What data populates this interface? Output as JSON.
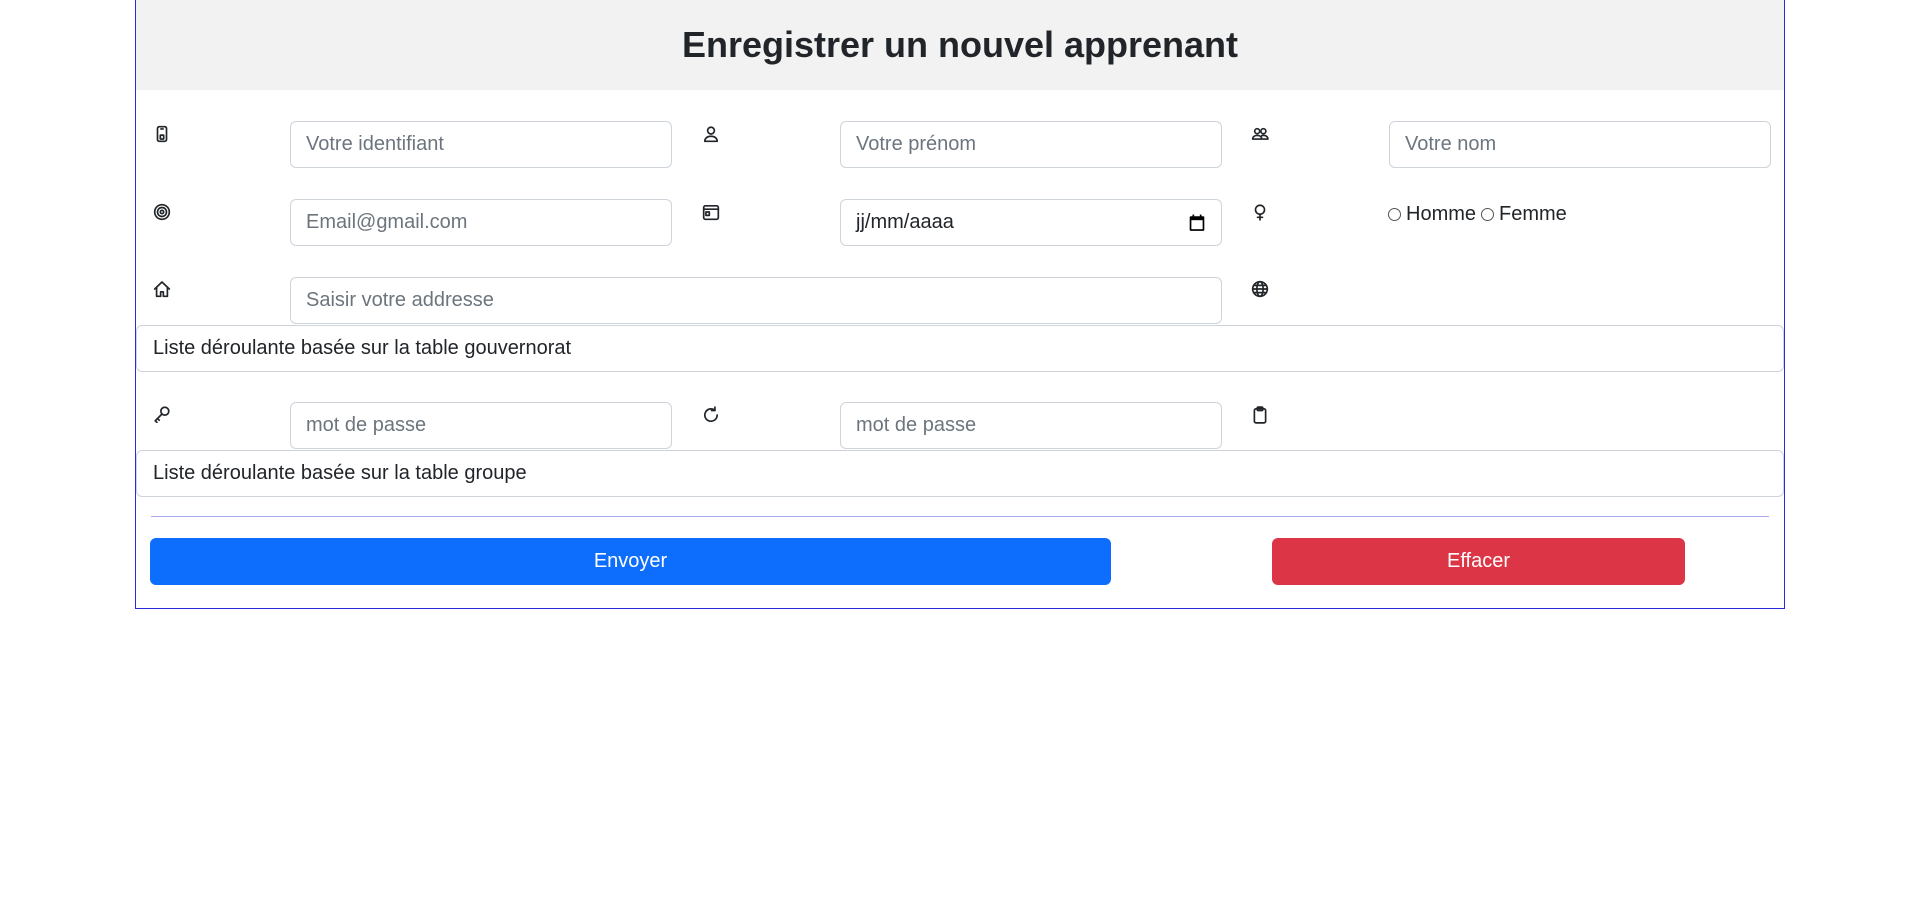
{
  "form": {
    "title": "Enregistrer un nouvel apprenant",
    "fields": {
      "identifiant": {
        "placeholder": "Votre identifiant",
        "value": ""
      },
      "prenom": {
        "placeholder": "Votre prénom",
        "value": ""
      },
      "nom": {
        "placeholder": "Votre nom",
        "value": ""
      },
      "email": {
        "placeholder": "Email@gmail.com",
        "value": ""
      },
      "date_naissance": {
        "display": "jj/mm/aaaa"
      },
      "adresse": {
        "placeholder": "Saisir votre addresse",
        "value": ""
      },
      "mot_de_passe": {
        "placeholder": "mot de passe",
        "value": ""
      },
      "confirmation_mot_de_passe": {
        "placeholder": "mot de passe",
        "value": ""
      }
    },
    "sexe": {
      "options": [
        {
          "label": "Homme",
          "selected": false
        },
        {
          "label": "Femme",
          "selected": false
        }
      ]
    },
    "gouvernorat_select": {
      "label": "Liste déroulante basée sur la table gouvernorat"
    },
    "groupe_select": {
      "label": "Liste déroulante basée sur la table groupe"
    },
    "buttons": {
      "send": "Envoyer",
      "clear": "Effacer"
    }
  },
  "icons": {
    "identifiant": "phone-id-icon",
    "prenom": "person-icon",
    "nom": "people-icon",
    "email": "at-target-icon",
    "date": "calendar-icon",
    "sexe": "gender-icon",
    "adresse": "house-icon",
    "gouvernorat": "globe-icon",
    "mot_de_passe": "key-icon",
    "confirmation": "refresh-icon",
    "groupe": "clipboard-icon"
  },
  "colors": {
    "card_border": "#2a2ad6",
    "header_bg": "#f2f2f2",
    "primary": "#0d6efd",
    "danger": "#dc3545",
    "divider": "#a7a7f0"
  }
}
